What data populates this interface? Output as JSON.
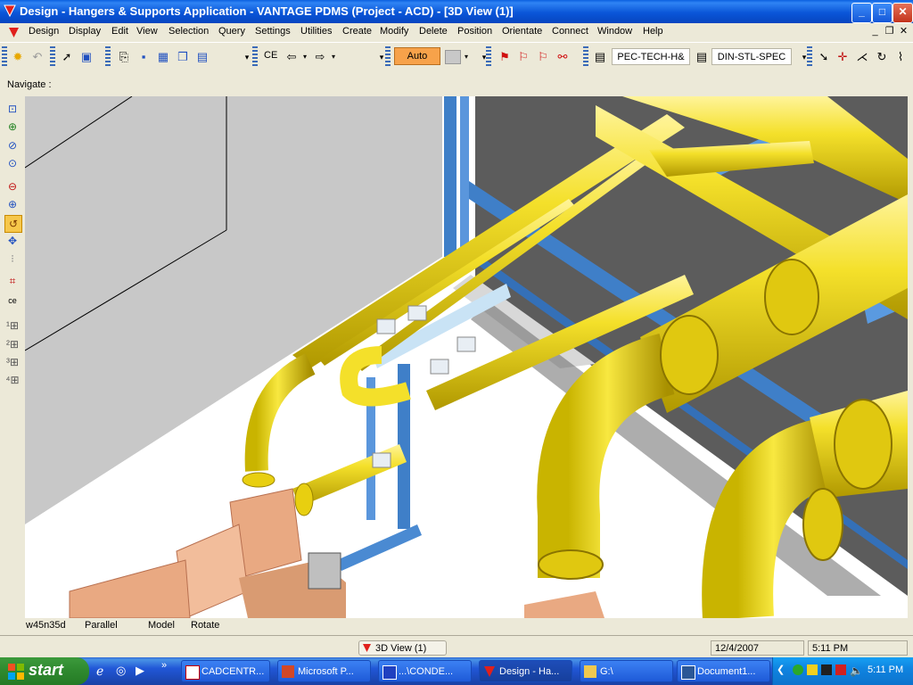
{
  "window": {
    "title": "Design - Hangers & Supports Application - VANTAGE PDMS (Project - ACD) - [3D View (1)]",
    "controls": [
      "minimize",
      "maximize",
      "close"
    ]
  },
  "menubar": {
    "items": [
      "Design",
      "Display",
      "Edit",
      "View",
      "Selection",
      "Query",
      "Settings",
      "Utilities",
      "Create",
      "Modify",
      "Delete",
      "Position",
      "Orientate",
      "Connect",
      "Window",
      "Help"
    ]
  },
  "toolbar": {
    "ce_label": "CE",
    "auto_label": "Auto",
    "spec1": "PEC-TECH-H&",
    "spec2": "DIN-STL-SPEC"
  },
  "navigate": {
    "label": "Navigate :"
  },
  "status": {
    "view_dir": "w45n35d",
    "projection": "Parallel",
    "mode": "Model",
    "action": "Rotate"
  },
  "winbar": {
    "view_tab": "3D View (1)",
    "date": "12/4/2007",
    "time": "5:11 PM"
  },
  "taskbar": {
    "start_label": "start",
    "tasks": [
      "CADCENTR...",
      "Microsoft P...",
      "...\\CONDE...",
      "Design - Ha...",
      "G:\\",
      "Document1..."
    ],
    "clock": "5:11 PM"
  },
  "colors": {
    "pipe": "#f4e02a",
    "pipe_shade": "#c9b400",
    "steel": "#3f7fc8",
    "pump": "#e9a982",
    "floor": "#ffffff",
    "wall": "#c8c8c8",
    "back_wall": "#5c5c5c"
  }
}
